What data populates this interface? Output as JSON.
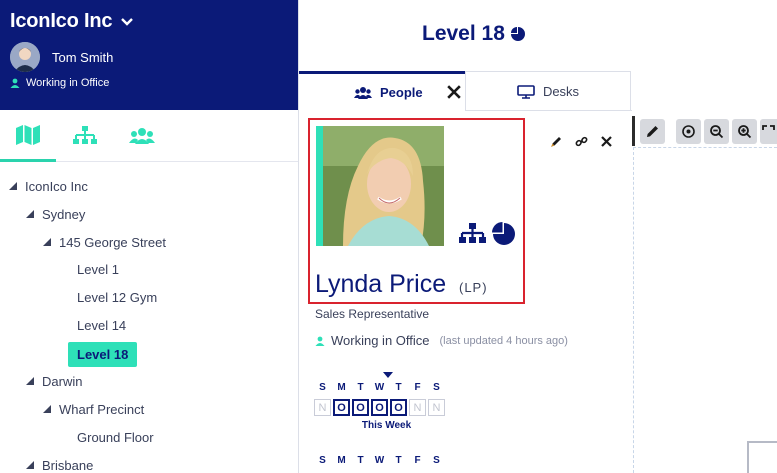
{
  "org": {
    "name": "IconIco Inc"
  },
  "user": {
    "name": "Tom Smith",
    "status": "Working in Office"
  },
  "left_tabs": [
    {
      "icon": "map-icon"
    },
    {
      "icon": "org-chart-icon"
    },
    {
      "icon": "people-group-icon"
    }
  ],
  "tree": [
    {
      "label": "IconIco Inc"
    },
    {
      "label": "Sydney"
    },
    {
      "label": "145 George Street"
    },
    {
      "label": "Level 1"
    },
    {
      "label": "Level 12 Gym"
    },
    {
      "label": "Level 14"
    },
    {
      "label": "Level 18",
      "selected": true
    },
    {
      "label": "Darwin"
    },
    {
      "label": "Wharf Precinct"
    },
    {
      "label": "Ground Floor"
    },
    {
      "label": "Brisbane"
    }
  ],
  "level": {
    "title": "Level 18"
  },
  "tabs": {
    "people": "People",
    "desks": "Desks"
  },
  "person": {
    "name": "Lynda Price",
    "initials": "(LP)",
    "role": "Sales Representative",
    "status": "Working in Office",
    "last_updated": "(last updated 4 hours ago)"
  },
  "week": {
    "days": [
      "S",
      "M",
      "T",
      "W",
      "T",
      "F",
      "S"
    ],
    "presence": [
      "N",
      "O",
      "O",
      "O",
      "O",
      "N",
      "N"
    ],
    "label": "This Week"
  },
  "week2": {
    "days": [
      "S",
      "M",
      "T",
      "W",
      "T",
      "F",
      "S"
    ]
  },
  "colors": {
    "navy": "#0b1a78",
    "accent": "#2ee0b8",
    "highlight": "#d9232e"
  }
}
